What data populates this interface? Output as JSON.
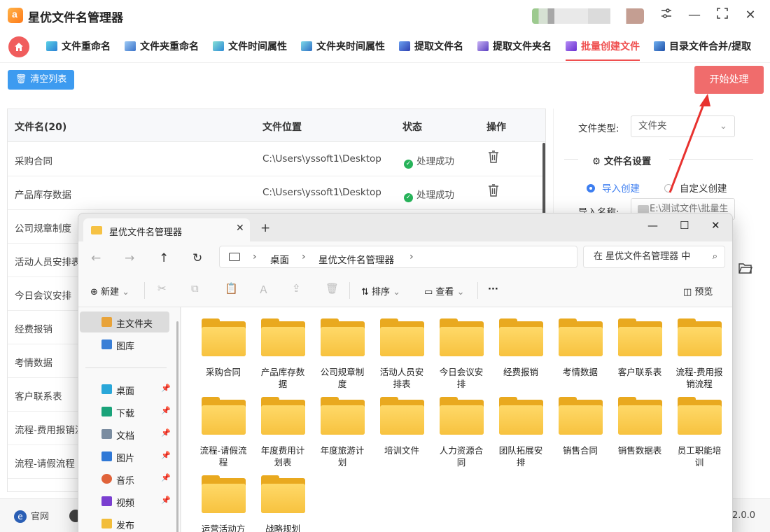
{
  "app": {
    "title": "星优文件名管理器",
    "version": "2.0.0",
    "official_label": "官网"
  },
  "tabs": [
    {
      "label": "文件重命名",
      "icon": "rename-file-icon"
    },
    {
      "label": "文件夹重命名",
      "icon": "rename-folder-icon"
    },
    {
      "label": "文件时间属性",
      "icon": "file-time-icon"
    },
    {
      "label": "文件夹时间属性",
      "icon": "folder-time-icon"
    },
    {
      "label": "提取文件名",
      "icon": "extract-filename-icon"
    },
    {
      "label": "提取文件夹名",
      "icon": "extract-foldername-icon"
    },
    {
      "label": "批量创建文件",
      "icon": "batch-create-icon",
      "active": true
    },
    {
      "label": "目录文件合并/提取",
      "icon": "merge-dir-icon"
    }
  ],
  "toolbar": {
    "clear_label": "清空列表",
    "start_label": "开始处理"
  },
  "table": {
    "headers": {
      "name": "文件名(20)",
      "location": "文件位置",
      "status": "状态",
      "action": "操作"
    },
    "rows": [
      {
        "name": "采购合同",
        "location": "C:\\Users\\yssoft1\\Desktop",
        "status": "处理成功"
      },
      {
        "name": "产品库存数据",
        "location": "C:\\Users\\yssoft1\\Desktop",
        "status": "处理成功"
      },
      {
        "name": "公司规章制度"
      },
      {
        "name": "活动人员安排表"
      },
      {
        "name": "今日会议安排"
      },
      {
        "name": "经费报销"
      },
      {
        "name": "考情数据"
      },
      {
        "name": "客户联系表"
      },
      {
        "name": "流程-费用报销流程"
      },
      {
        "name": "流程-请假流程"
      }
    ]
  },
  "settings": {
    "file_type_label": "文件类型:",
    "file_type_value": "文件夹",
    "section_title": "文件名设置",
    "radio_import": "导入创建",
    "radio_custom": "自定义创建",
    "import_name_label": "导入名称:",
    "import_path": "E:\\测试文件\\批量生"
  },
  "explorer": {
    "tab_title": "星优文件名管理器",
    "breadcrumb": [
      "桌面",
      "星优文件名管理器"
    ],
    "search_placeholder": "在 星优文件名管理器 中",
    "commands": {
      "new": "新建",
      "sort": "排序",
      "view": "查看",
      "more": "···",
      "preview": "预览"
    },
    "sidebar": [
      {
        "label": "主文件夹",
        "icon": "home-icon",
        "selected": true
      },
      {
        "label": "图库",
        "icon": "gallery-icon"
      },
      {
        "label": "桌面",
        "icon": "desktop-icon",
        "pinned": true
      },
      {
        "label": "下载",
        "icon": "download-icon",
        "pinned": true
      },
      {
        "label": "文档",
        "icon": "document-icon",
        "pinned": true
      },
      {
        "label": "图片",
        "icon": "pictures-icon",
        "pinned": true
      },
      {
        "label": "音乐",
        "icon": "music-icon",
        "pinned": true
      },
      {
        "label": "视频",
        "icon": "video-icon",
        "pinned": true
      },
      {
        "label": "发布",
        "icon": "folder-icon"
      }
    ],
    "folders": [
      "采购合同",
      "产品库存数据",
      "公司规章制度",
      "活动人员安排表",
      "今日会议安排",
      "经费报销",
      "考情数据",
      "客户联系表",
      "流程-费用报销流程",
      "流程-请假流程",
      "年度费用计划表",
      "年度旅游计划",
      "培训文件",
      "人力资源合同",
      "团队拓展安排",
      "销售合同",
      "销售数据表",
      "员工职能培训",
      "运营活动方",
      "战略规划"
    ]
  },
  "colors": {
    "accent": "#ef4f4f",
    "primary": "#3d9bf0",
    "success": "#27b35a",
    "folder": "#f7c23f"
  }
}
